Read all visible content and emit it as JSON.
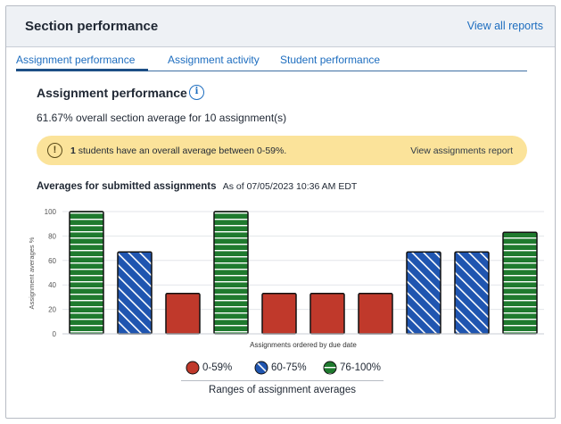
{
  "header": {
    "title": "Section performance",
    "view_all_label": "View all reports"
  },
  "tabs": [
    {
      "label": "Assignment performance",
      "active": true
    },
    {
      "label": "Assignment activity",
      "active": false
    },
    {
      "label": "Student performance",
      "active": false
    }
  ],
  "section": {
    "title": "Assignment performance",
    "info_icon": "info-icon",
    "average_text": "61.67% overall section average for 10 assignment(s)"
  },
  "alert": {
    "icon": "warning-icon",
    "count": "1",
    "message": " students have an overall average between 0-59%.",
    "link_label": "View assignments report"
  },
  "chart_heading": {
    "title": "Averages for submitted assignments",
    "as_of": "As of 07/05/2023 10:36 AM EDT"
  },
  "chart_data": {
    "type": "bar",
    "title": "Averages for submitted assignments",
    "xlabel": "Assignments ordered by due date",
    "ylabel": "Assignment averages %",
    "ylim": [
      0,
      100
    ],
    "yticks": [
      0,
      20,
      40,
      60,
      80,
      100
    ],
    "grid": true,
    "values": [
      100,
      67,
      33,
      100,
      33,
      33,
      33,
      67,
      67,
      83
    ],
    "ranges": [
      {
        "label": "0-59%",
        "min": 0,
        "max": 59,
        "color": "#c0392b",
        "pattern": "solid"
      },
      {
        "label": "60-75%",
        "min": 60,
        "max": 75,
        "color": "#1f55b0",
        "pattern": "diagonal-stripes"
      },
      {
        "label": "76-100%",
        "min": 76,
        "max": 100,
        "color": "#1f7a2e",
        "pattern": "horizontal-stripes"
      }
    ],
    "legend_caption": "Ranges of assignment averages",
    "legend_placement": "bottom-center"
  }
}
